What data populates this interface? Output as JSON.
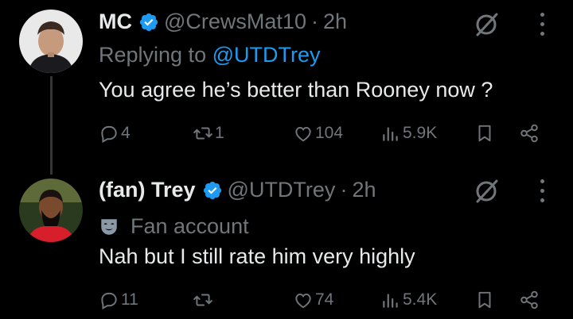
{
  "tweets": [
    {
      "name": "MC",
      "handle": "@CrewsMat10",
      "separator": "·",
      "time": "2h",
      "replying_prefix": "Replying to ",
      "replying_to": "@UTDTrey",
      "text": "You agree he’s better than Rooney now ?",
      "replies": "4",
      "retweets": "1",
      "likes": "104",
      "views": "5.9K"
    },
    {
      "name": "(fan) Trey",
      "handle": "@UTDTrey",
      "separator": "·",
      "time": "2h",
      "label": "Fan account",
      "text": "Nah but I still rate him very highly",
      "replies": "11",
      "retweets": "",
      "likes": "74",
      "views": "5.4K"
    }
  ],
  "colors": {
    "background": "#000000",
    "text": "#e7e9ea",
    "muted": "#71767b",
    "accent": "#1d9bf0"
  },
  "icons": [
    "verified-badge-icon",
    "grok-icon",
    "more-icon",
    "reply-icon",
    "retweet-icon",
    "like-icon",
    "views-icon",
    "bookmark-icon",
    "share-icon",
    "fan-mask-icon"
  ]
}
